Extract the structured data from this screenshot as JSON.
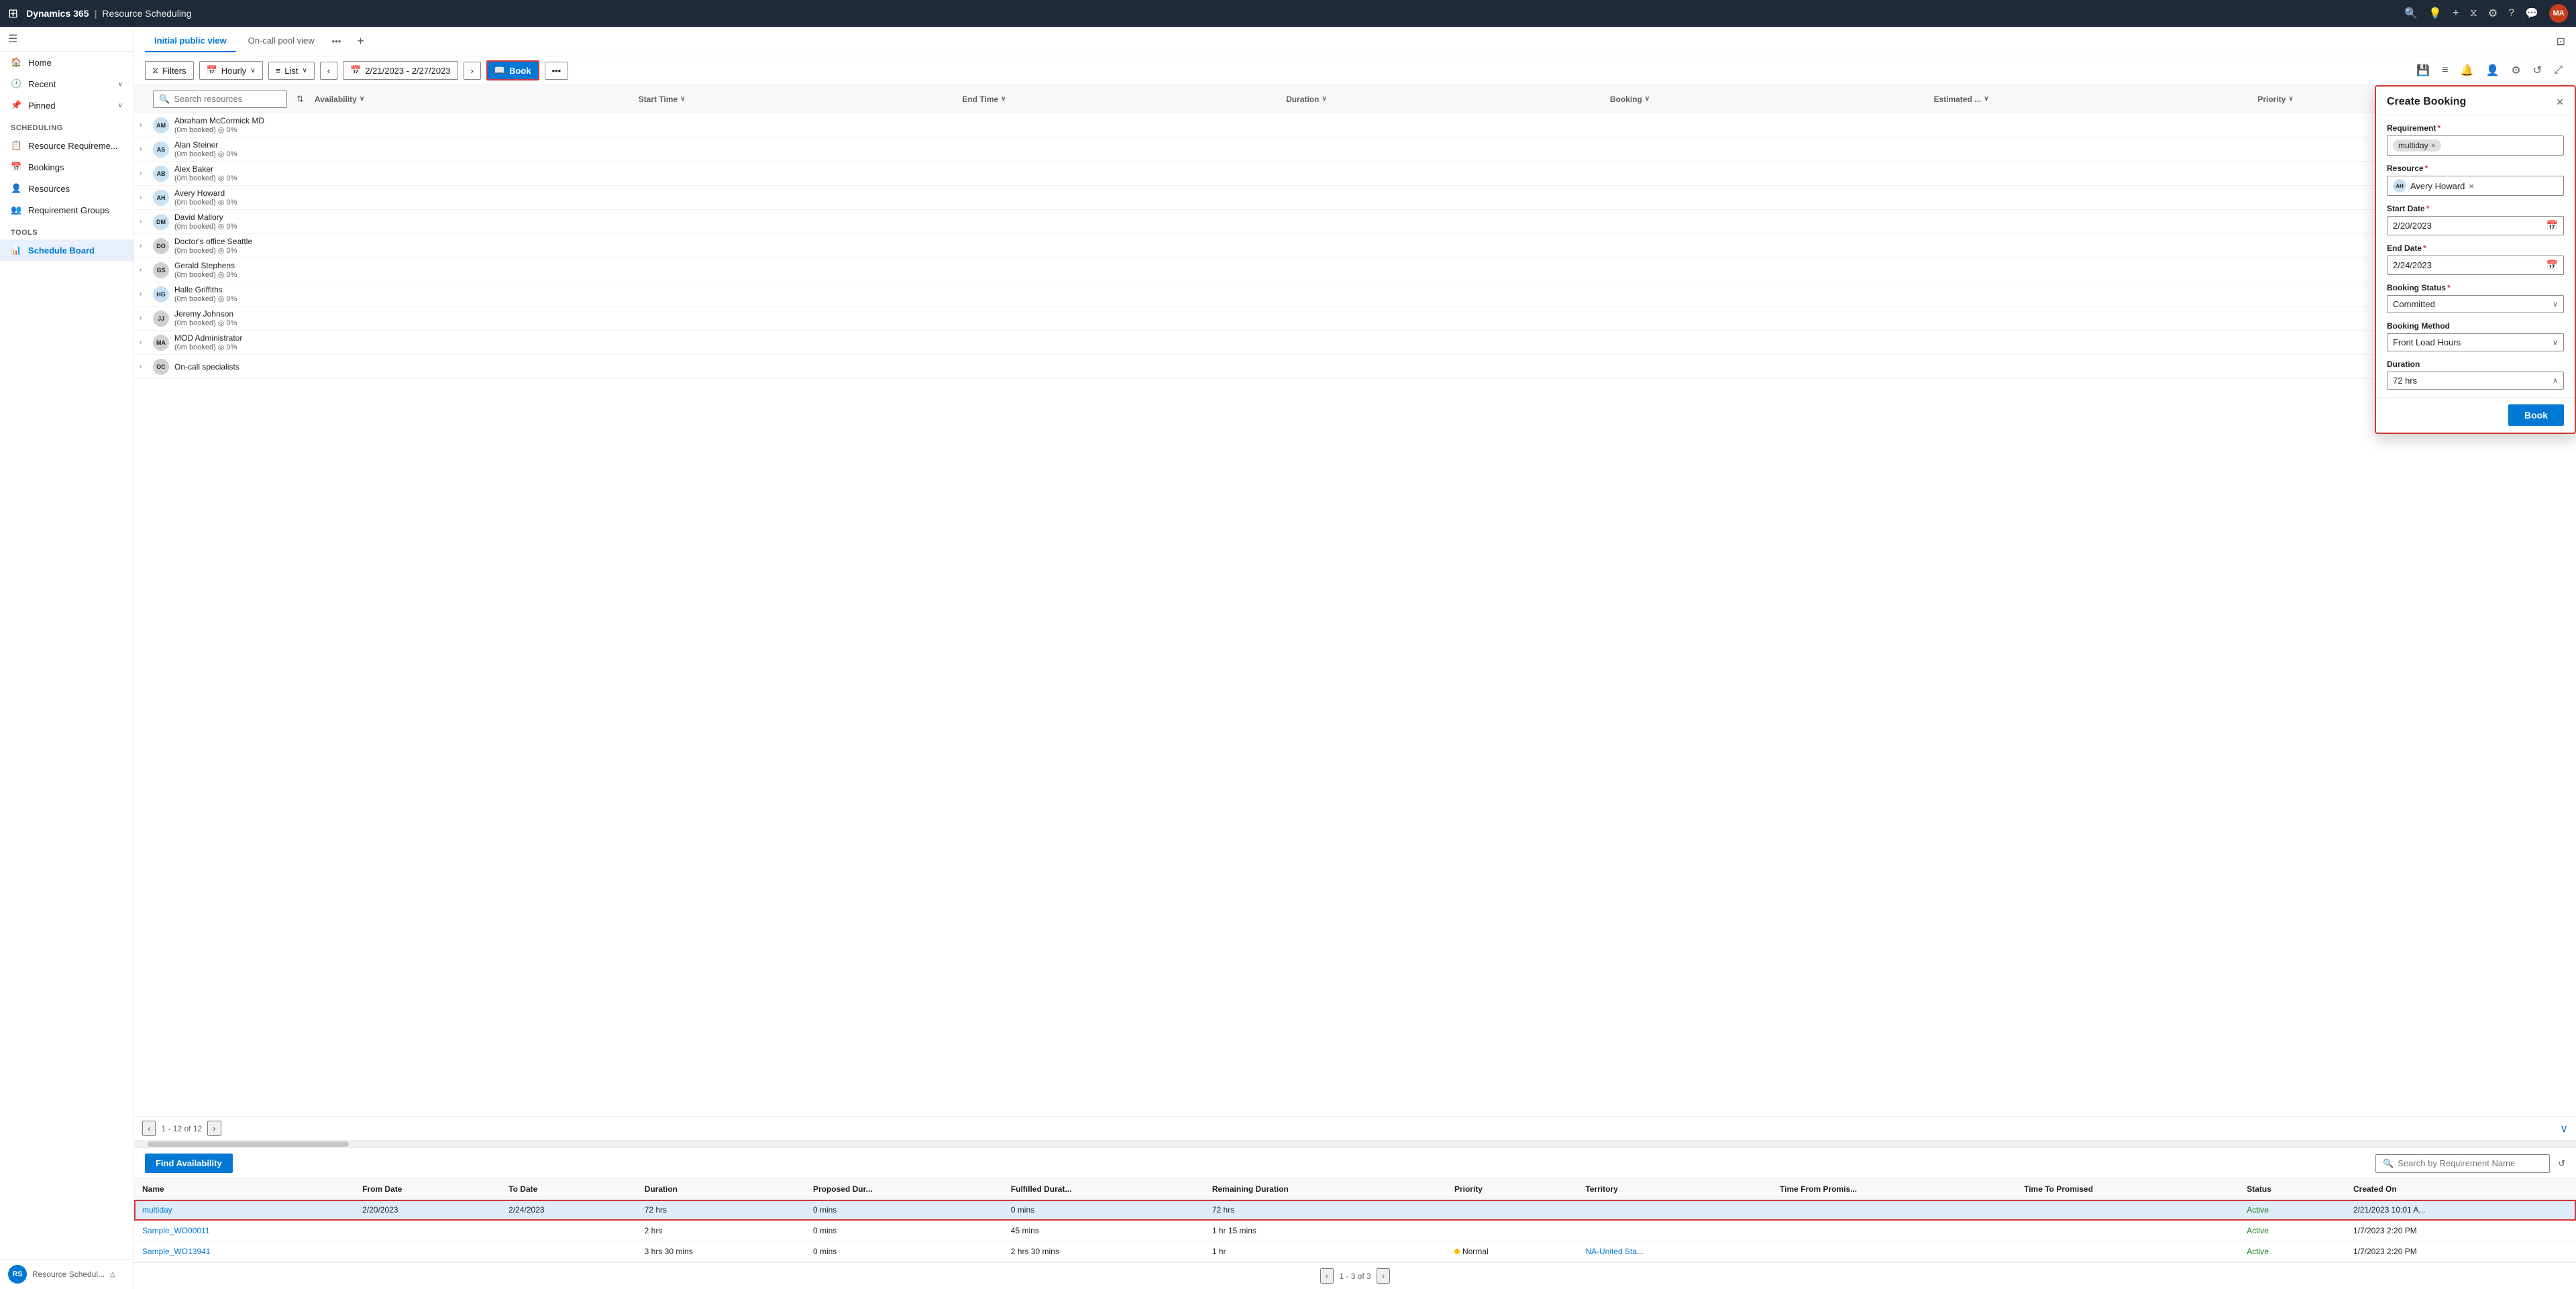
{
  "topNav": {
    "appGrid": "⊞",
    "brand": "Dynamics 365",
    "separator": "|",
    "appName": "Resource Scheduling",
    "icons": {
      "search": "🔍",
      "lightning": "⚡",
      "plus": "+",
      "filter": "⧖",
      "settings": "⚙",
      "help": "?",
      "chat": "💬"
    },
    "avatar": "MA"
  },
  "sidebar": {
    "menuIcon": "☰",
    "items": [
      {
        "id": "home",
        "label": "Home",
        "icon": "🏠"
      },
      {
        "id": "recent",
        "label": "Recent",
        "icon": "🕐",
        "hasChevron": true
      },
      {
        "id": "pinned",
        "label": "Pinned",
        "icon": "📌",
        "hasChevron": true
      }
    ],
    "schedulingSection": "Scheduling",
    "schedulingItems": [
      {
        "id": "resource-req",
        "label": "Resource Requireme...",
        "icon": "📋"
      },
      {
        "id": "bookings",
        "label": "Bookings",
        "icon": "📅"
      },
      {
        "id": "resources",
        "label": "Resources",
        "icon": "👤"
      },
      {
        "id": "req-groups",
        "label": "Requirement Groups",
        "icon": "👥"
      }
    ],
    "toolsSection": "Tools",
    "toolsItems": [
      {
        "id": "schedule-board",
        "label": "Schedule Board",
        "icon": "📊",
        "active": true
      }
    ],
    "bottomUser": "RS",
    "bottomUserLabel": "Resource Schedul...",
    "bottomChevron": "△"
  },
  "tabs": [
    {
      "id": "initial-public",
      "label": "Initial public view",
      "active": true
    },
    {
      "id": "on-call-pool",
      "label": "On-call pool view",
      "active": false
    }
  ],
  "toolbar": {
    "filterLabel": "Filters",
    "viewLabel": "Hourly",
    "listLabel": "List",
    "dateRange": "2/21/2023 - 2/27/2023",
    "bookLabel": "Book",
    "moreIcon": "•••",
    "icons": {
      "save": "💾",
      "list": "≡",
      "bell": "🔔",
      "person": "👤",
      "settings": "⚙",
      "refresh": "↺",
      "expand": "⤢"
    }
  },
  "scheduleHeader": {
    "searchPlaceholder": "Search resources",
    "sortIcon": "⇅",
    "columns": [
      {
        "id": "availability",
        "label": "Availability"
      },
      {
        "id": "start-time",
        "label": "Start Time"
      },
      {
        "id": "end-time",
        "label": "End Time"
      },
      {
        "id": "duration",
        "label": "Duration"
      },
      {
        "id": "booking",
        "label": "Booking"
      },
      {
        "id": "estimated",
        "label": "Estimated ..."
      },
      {
        "id": "priority",
        "label": "Priority"
      }
    ]
  },
  "resources": [
    {
      "id": "r1",
      "name": "Abraham McCormick MD",
      "meta": "(0m booked) ◎ 0%",
      "avatarColor": "#c7e0f4",
      "initials": "AM",
      "grey": false
    },
    {
      "id": "r2",
      "name": "Alan Steiner",
      "meta": "(0m booked) ◎ 0%",
      "avatarColor": "#c7e0f4",
      "initials": "AS",
      "grey": false
    },
    {
      "id": "r3",
      "name": "Alex Baker",
      "meta": "(0m booked) ◎ 0%",
      "avatarColor": "#c7e0f4",
      "initials": "AB",
      "grey": false
    },
    {
      "id": "r4",
      "name": "Avery Howard",
      "meta": "(0m booked) ◎ 0%",
      "avatarColor": "#c7e0f4",
      "initials": "AH",
      "grey": false
    },
    {
      "id": "r5",
      "name": "David Mallory",
      "meta": "(0m booked) ◎ 0%",
      "avatarColor": "#c7e0f4",
      "initials": "DM",
      "grey": false
    },
    {
      "id": "r6",
      "name": "Doctor's office Seattle",
      "meta": "(0m booked) ◎ 0%",
      "avatarColor": "#d2d0ce",
      "initials": "DO",
      "grey": true
    },
    {
      "id": "r7",
      "name": "Gerald Stephens",
      "meta": "(0m booked) ◎ 0%",
      "avatarColor": "#d2d0ce",
      "initials": "GS",
      "grey": true
    },
    {
      "id": "r8",
      "name": "Halle Griffiths",
      "meta": "(0m booked) ◎ 0%",
      "avatarColor": "#c7e0f4",
      "initials": "HG",
      "grey": false
    },
    {
      "id": "r9",
      "name": "Jeremy Johnson",
      "meta": "(0m booked) ◎ 0%",
      "avatarColor": "#d2d0ce",
      "initials": "JJ",
      "grey": true
    },
    {
      "id": "r10",
      "name": "MOD Administrator",
      "meta": "(0m booked) ◎ 0%",
      "avatarColor": "#d2d0ce",
      "initials": "MA",
      "grey": true
    },
    {
      "id": "r11",
      "name": "On-call specialists",
      "meta": "",
      "avatarColor": "#d2d0ce",
      "initials": "OC",
      "grey": true
    }
  ],
  "pagination": {
    "prev": "‹",
    "next": "›",
    "info": "1 - 12 of 12",
    "expandIcon": "∨"
  },
  "bottomPanel": {
    "findAvailLabel": "Find Availability",
    "searchPlaceholder": "Search by Requirement Name",
    "refreshIcon": "↺",
    "columns": [
      "Name",
      "From Date",
      "To Date",
      "Duration",
      "Proposed Dur...",
      "Fulfilled Durat...",
      "Remaining Duration",
      "Priority",
      "Territory",
      "Time From Promis...",
      "Time To Promised",
      "Status",
      "Created On"
    ],
    "rows": [
      {
        "id": "req1",
        "name": "multiday",
        "fromDate": "2/20/2023",
        "toDate": "2/24/2023",
        "duration": "72 hrs",
        "proposedDur": "0 mins",
        "fulfilledDur": "0 mins",
        "remainingDur": "72 hrs",
        "priority": "",
        "territory": "",
        "timeFromPromised": "",
        "timeToPromised": "",
        "status": "Active",
        "createdOn": "2/21/2023 10:01 A...",
        "selected": true
      },
      {
        "id": "req2",
        "name": "Sample_WO00011",
        "fromDate": "",
        "toDate": "",
        "duration": "2 hrs",
        "proposedDur": "0 mins",
        "fulfilledDur": "45 mins",
        "remainingDur": "1 hr 15 mins",
        "priority": "",
        "territory": "",
        "timeFromPromised": "",
        "timeToPromised": "",
        "status": "Active",
        "createdOn": "1/7/2023 2:20 PM",
        "selected": false
      },
      {
        "id": "req3",
        "name": "Sample_WO13941",
        "fromDate": "",
        "toDate": "",
        "duration": "3 hrs 30 mins",
        "proposedDur": "0 mins",
        "fulfilledDur": "2 hrs 30 mins",
        "remainingDur": "1 hr",
        "priority": "Normal",
        "territory": "NA-United Sta...",
        "timeFromPromised": "",
        "timeToPromised": "",
        "status": "Active",
        "createdOn": "1/7/2023 2:20 PM",
        "selected": false
      }
    ],
    "bottomPagination": {
      "prev": "‹",
      "next": "›",
      "info": "1 - 3 of 3"
    }
  },
  "bookingPanel": {
    "title": "Create Booking",
    "closeIcon": "✕",
    "fields": {
      "requirement": {
        "label": "Requirement",
        "required": true,
        "value": "multiday"
      },
      "resource": {
        "label": "Resource",
        "required": true,
        "value": "Avery Howard",
        "initials": "AH"
      },
      "startDate": {
        "label": "Start Date",
        "required": true,
        "value": "2/20/2023"
      },
      "endDate": {
        "label": "End Date",
        "required": true,
        "value": "2/24/2023"
      },
      "bookingStatus": {
        "label": "Booking Status",
        "required": true,
        "value": "Committed"
      },
      "bookingMethod": {
        "label": "Booking Method",
        "value": "Front Load Hours"
      },
      "duration": {
        "label": "Duration",
        "value": "72 hrs"
      }
    },
    "bookButtonLabel": "Book"
  }
}
